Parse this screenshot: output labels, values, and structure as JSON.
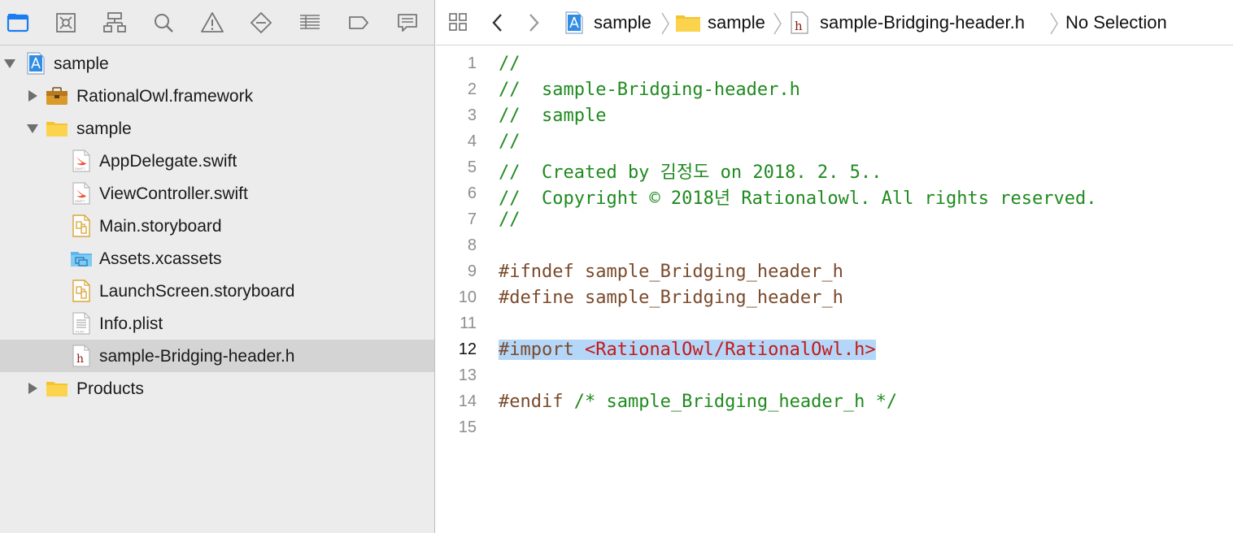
{
  "navigator": {
    "toolbar_icons": [
      "project-navigator-icon",
      "source-control-icon",
      "symbol-navigator-icon",
      "find-navigator-icon",
      "issue-navigator-icon",
      "test-navigator-icon",
      "debug-navigator-icon",
      "breakpoint-navigator-icon",
      "report-navigator-icon"
    ],
    "tree": [
      {
        "label": "sample",
        "icon": "xcode-project-icon",
        "depth": 0,
        "disclosure": "expanded"
      },
      {
        "label": "RationalOwl.framework",
        "icon": "framework-toolbox-icon",
        "depth": 1,
        "disclosure": "collapsed"
      },
      {
        "label": "sample",
        "icon": "folder-icon",
        "depth": 1,
        "disclosure": "expanded"
      },
      {
        "label": "AppDelegate.swift",
        "icon": "swift-file-icon",
        "depth": 2
      },
      {
        "label": "ViewController.swift",
        "icon": "swift-file-icon",
        "depth": 2
      },
      {
        "label": "Main.storyboard",
        "icon": "storyboard-file-icon",
        "depth": 2
      },
      {
        "label": "Assets.xcassets",
        "icon": "asset-catalog-icon",
        "depth": 2
      },
      {
        "label": "LaunchScreen.storyboard",
        "icon": "storyboard-file-icon",
        "depth": 2
      },
      {
        "label": "Info.plist",
        "icon": "plist-file-icon",
        "depth": 2
      },
      {
        "label": "sample-Bridging-header.h",
        "icon": "header-file-icon",
        "depth": 2,
        "selected": true
      },
      {
        "label": "Products",
        "icon": "folder-icon",
        "depth": 1,
        "disclosure": "collapsed"
      }
    ],
    "selected_color": "#d4d4d4"
  },
  "jumpbar": {
    "project": "sample",
    "group": "sample",
    "file": "sample-Bridging-header.h",
    "file_icon_glyph": "h",
    "symbol": "No Selection"
  },
  "editor": {
    "current_line": 12,
    "lines": [
      {
        "n": "1",
        "text": "//",
        "kind": "comment"
      },
      {
        "n": "2",
        "text": "//  sample-Bridging-header.h",
        "kind": "comment"
      },
      {
        "n": "3",
        "text": "//  sample",
        "kind": "comment"
      },
      {
        "n": "4",
        "text": "//",
        "kind": "comment"
      },
      {
        "n": "5",
        "text": "//  Created by 김정도 on 2018. 2. 5..",
        "kind": "comment"
      },
      {
        "n": "6",
        "text": "//  Copyright © 2018년 Rationalowl. All rights reserved.",
        "kind": "comment"
      },
      {
        "n": "7",
        "text": "//",
        "kind": "comment"
      },
      {
        "n": "8",
        "text": "",
        "kind": "plain"
      },
      {
        "n": "9",
        "text": "#ifndef sample_Bridging_header_h",
        "kind": "prep"
      },
      {
        "n": "10",
        "text": "#define sample_Bridging_header_h",
        "kind": "prep"
      },
      {
        "n": "11",
        "text": "",
        "kind": "plain"
      },
      {
        "n": "12",
        "text": "#import ",
        "kind": "prep",
        "string": "<RationalOwl/RationalOwl.h>",
        "highlighted": true
      },
      {
        "n": "13",
        "text": "",
        "kind": "plain"
      },
      {
        "n": "14",
        "text": "#endif ",
        "kind": "prep",
        "comment": "/* sample_Bridging_header_h */"
      },
      {
        "n": "15",
        "text": "",
        "kind": "plain"
      }
    ],
    "colors": {
      "comment": "#1f8a1f",
      "preprocessor": "#7a4a2b",
      "string": "#c41a16",
      "highlight": "#b4d6f8"
    }
  }
}
